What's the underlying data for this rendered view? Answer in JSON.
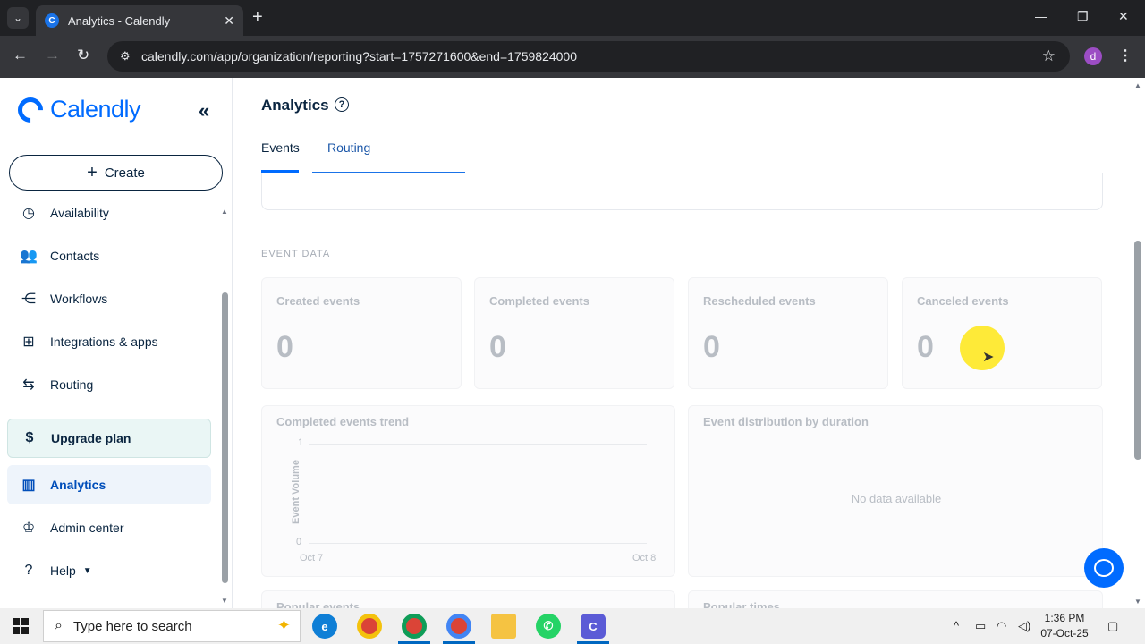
{
  "browser": {
    "tab_title": "Analytics - Calendly",
    "url": "calendly.com/app/organization/reporting?start=1757271600&end=1759824000",
    "profile_initial": "d"
  },
  "sidebar": {
    "brand": "Calendly",
    "create_label": "Create",
    "items": [
      {
        "label": "Availability",
        "icon": "clock-icon"
      },
      {
        "label": "Contacts",
        "icon": "contacts-icon"
      },
      {
        "label": "Workflows",
        "icon": "workflow-icon"
      },
      {
        "label": "Integrations & apps",
        "icon": "grid-icon"
      },
      {
        "label": "Routing",
        "icon": "routing-icon"
      },
      {
        "label": "Upgrade plan",
        "icon": "dollar-icon"
      },
      {
        "label": "Analytics",
        "icon": "bar-chart-icon"
      },
      {
        "label": "Admin center",
        "icon": "crown-icon"
      },
      {
        "label": "Help",
        "icon": "help-icon"
      }
    ]
  },
  "main": {
    "title": "Analytics",
    "tabs": [
      {
        "label": "Events",
        "active": true
      },
      {
        "label": "Routing",
        "active": false
      }
    ],
    "section_label": "EVENT DATA",
    "stats": [
      {
        "label": "Created events",
        "value": "0"
      },
      {
        "label": "Completed events",
        "value": "0"
      },
      {
        "label": "Rescheduled events",
        "value": "0"
      },
      {
        "label": "Canceled events",
        "value": "0"
      }
    ],
    "trend": {
      "title": "Completed events trend",
      "y_axis_label": "Event Volume",
      "y_ticks": [
        "1",
        "0"
      ],
      "x_ticks": [
        "Oct 7",
        "Oct 8"
      ]
    },
    "distribution": {
      "title": "Event distribution by duration",
      "empty_text": "No data available"
    },
    "popular_events_title": "Popular events",
    "popular_times_title": "Popular times"
  },
  "taskbar": {
    "search_placeholder": "Type here to search",
    "time": "1:36 PM",
    "date": "07-Oct-25"
  },
  "colors": {
    "brand": "#006bff",
    "text": "#0a2540",
    "muted": "#b8bdc4"
  }
}
